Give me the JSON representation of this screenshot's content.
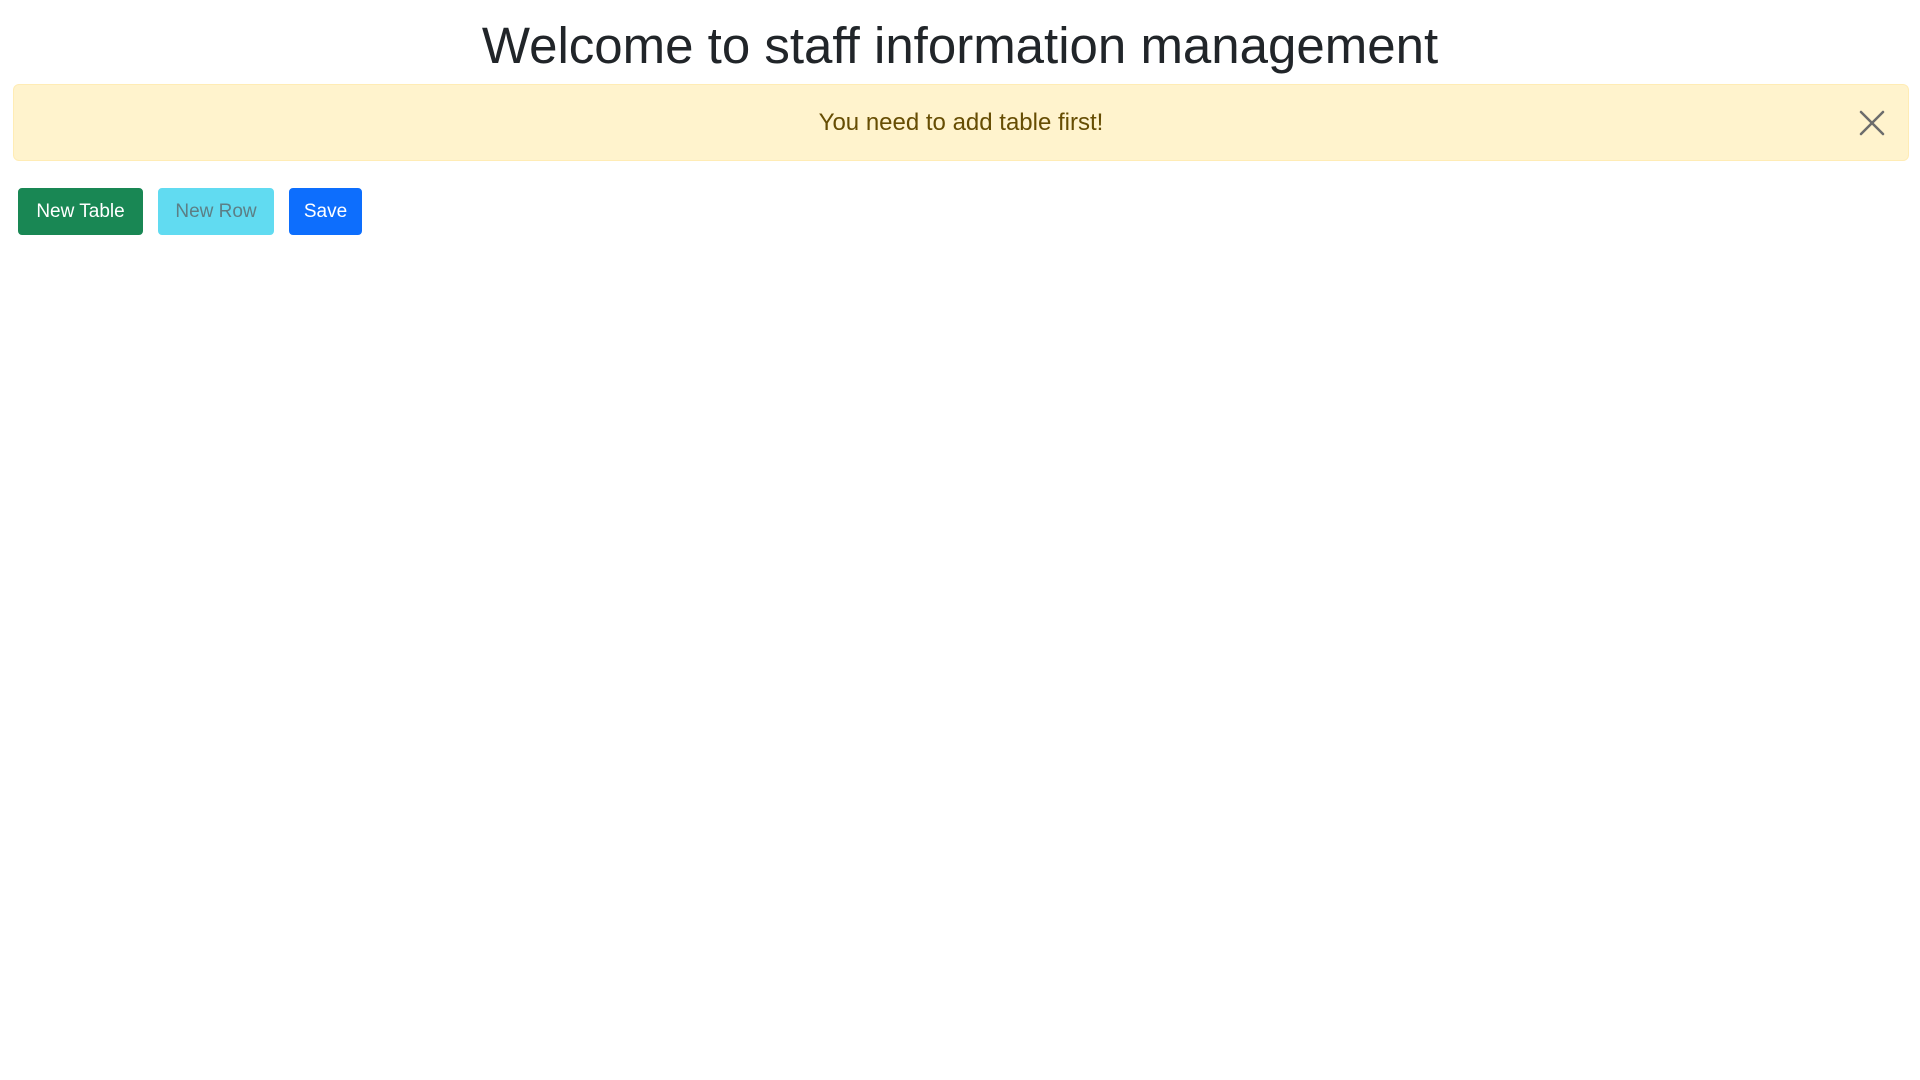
{
  "header": {
    "title": "Welcome to staff information management"
  },
  "alert": {
    "message": "You need to add table first!",
    "close_icon": "close-icon",
    "background_color": "#fff3cd",
    "text_color": "#664d03"
  },
  "toolbar": {
    "new_table_label": "New Table",
    "new_row_label": "New Row",
    "new_row_disabled": true,
    "save_label": "Save",
    "colors": {
      "new_table": "#198754",
      "new_row": "#61dbf1",
      "save": "#0d6efd"
    }
  }
}
